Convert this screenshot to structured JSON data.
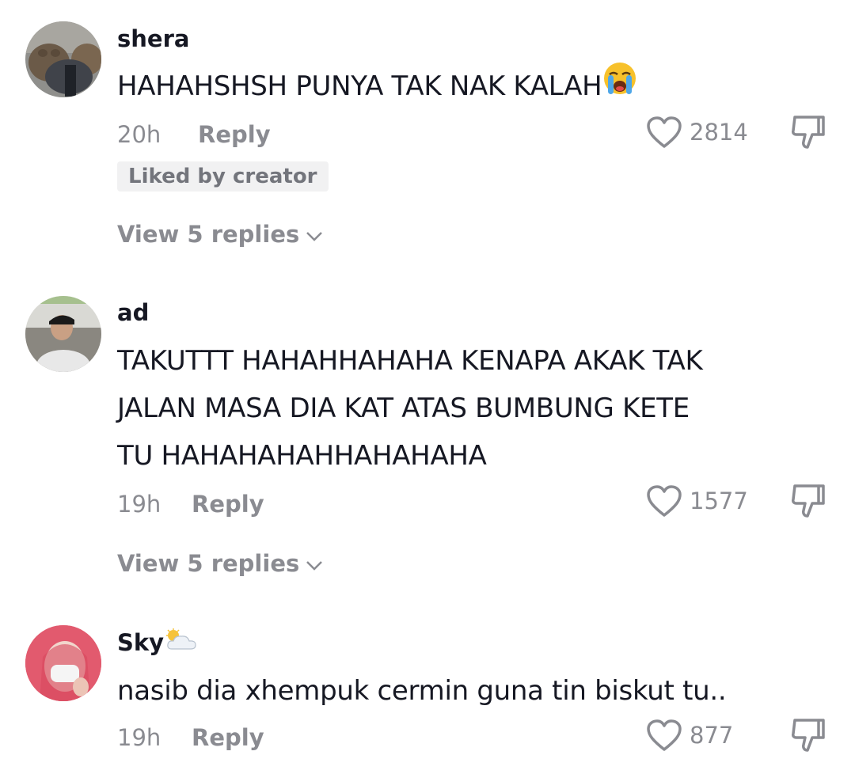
{
  "comments": [
    {
      "username": "shera",
      "text": "HAHAHSHSH PUNYA TAK NAK KALAH",
      "text_emoji": "crying-face",
      "time": "20h",
      "reply_label": "Reply",
      "likes": "2814",
      "badge": "Liked by creator",
      "view_replies": "View 5 replies"
    },
    {
      "username": "ad",
      "text_line1": "TAKUTTT HAHAHHAHAHA KENAPA AKAK TAK",
      "text_line2": "JALAN MASA DIA KAT ATAS BUMBUNG KETE",
      "text_line3": "TU HAHAHAHAHHAHAHAHA",
      "time": "19h",
      "reply_label": "Reply",
      "likes": "1577",
      "view_replies": "View 5 replies"
    },
    {
      "username": "Sky",
      "username_emoji": "sun-behind-cloud",
      "text": "nasib dia xhempuk cermin guna tin biskut tu..",
      "time": "19h",
      "reply_label": "Reply",
      "likes": "877"
    }
  ],
  "colors": {
    "text_primary": "#161823",
    "text_secondary": "#8a8b91",
    "badge_bg": "#f1f1f2"
  }
}
